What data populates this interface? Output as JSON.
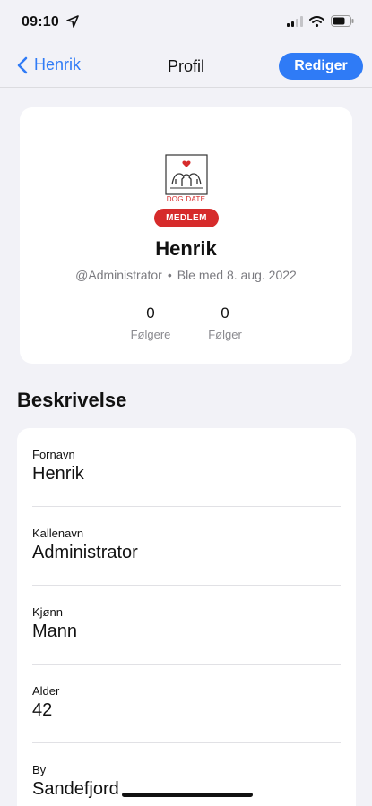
{
  "status_bar": {
    "time": "09:10"
  },
  "nav": {
    "back_label": "Henrik",
    "title": "Profil",
    "edit_label": "Rediger"
  },
  "profile": {
    "logo_text": "DOG DATE",
    "badge": "MEDLEM",
    "name": "Henrik",
    "username": "@Administrator",
    "joined": "Ble med 8. aug. 2022",
    "stats": [
      {
        "value": "0",
        "label": "Følgere"
      },
      {
        "value": "0",
        "label": "Følger"
      }
    ]
  },
  "description": {
    "title": "Beskrivelse",
    "fields": [
      {
        "label": "Fornavn",
        "value": "Henrik"
      },
      {
        "label": "Kallenavn",
        "value": "Administrator"
      },
      {
        "label": "Kjønn",
        "value": "Mann"
      },
      {
        "label": "Alder",
        "value": "42"
      },
      {
        "label": "By",
        "value": "Sandefjord"
      }
    ]
  },
  "colors": {
    "accent": "#2f7bf6",
    "badge": "#d62b2b",
    "background": "#f2f2f7"
  },
  "icons": [
    "location-arrow-icon",
    "signal-icon",
    "wifi-icon",
    "battery-icon",
    "chevron-left-icon",
    "dog-date-logo-icon"
  ]
}
